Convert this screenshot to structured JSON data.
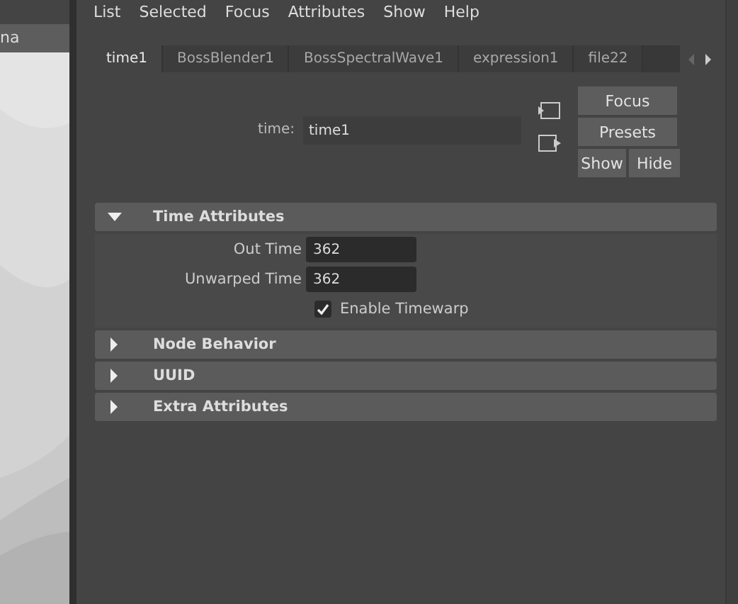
{
  "outliner": {
    "header": "na"
  },
  "menu": [
    "List",
    "Selected",
    "Focus",
    "Attributes",
    "Show",
    "Help"
  ],
  "tabs": [
    {
      "label": "time1",
      "selected": true
    },
    {
      "label": "BossBlender1",
      "selected": false
    },
    {
      "label": "BossSpectralWave1",
      "selected": false
    },
    {
      "label": "expression1",
      "selected": false
    },
    {
      "label": "file22",
      "selected": false
    }
  ],
  "node": {
    "label": "time:",
    "value": "time1"
  },
  "buttons": {
    "focus": "Focus",
    "presets": "Presets",
    "show": "Show",
    "hide": "Hide"
  },
  "sections": [
    {
      "title": "Time Attributes",
      "expanded": true,
      "rows": [
        {
          "kind": "field",
          "label": "Out Time",
          "value": "362"
        },
        {
          "kind": "field",
          "label": "Unwarped Time",
          "value": "362"
        },
        {
          "kind": "checkbox",
          "label": "Enable Timewarp",
          "checked": true
        }
      ]
    },
    {
      "title": "Node Behavior",
      "expanded": false
    },
    {
      "title": "UUID",
      "expanded": false
    },
    {
      "title": "Extra Attributes",
      "expanded": false
    }
  ]
}
